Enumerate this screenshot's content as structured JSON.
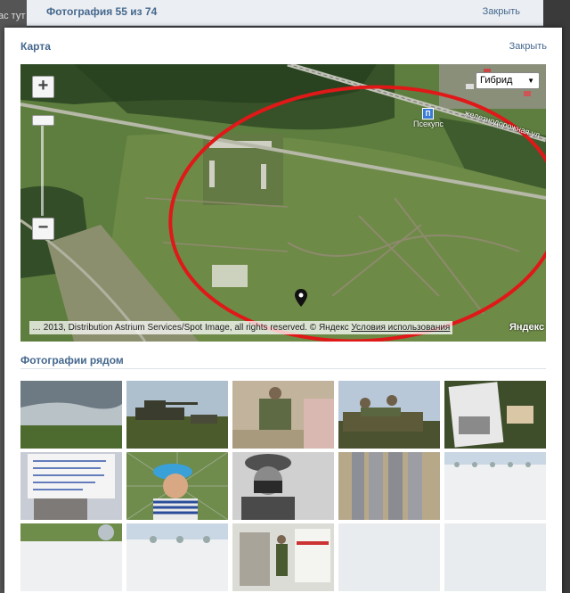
{
  "background": {
    "left_fragment": "ас тут",
    "header_title": "Фотография 55 из 74",
    "header_close": "Закрыть"
  },
  "modal": {
    "title": "Карта",
    "close": "Закрыть"
  },
  "map": {
    "layer_select": "Гибрид",
    "zoom_in": "+",
    "zoom_out": "−",
    "station_label": "Псекупс",
    "road_label": "железнодорожная ул",
    "copyright": "… 2013, Distribution Astrium Services/Spot Image, all rights reserved. © Яндекс",
    "terms": "Условия использования",
    "provider": "Яндекс"
  },
  "nearby": {
    "title": "Фотографии рядом",
    "photos": [
      {
        "subject": "cloudy field"
      },
      {
        "subject": "tanks on field"
      },
      {
        "subject": "soldier sitting"
      },
      {
        "subject": "soldiers on tank"
      },
      {
        "subject": "leaflet and paper"
      },
      {
        "subject": "handwritten letter"
      },
      {
        "subject": "soldier selfie"
      },
      {
        "subject": "soldier portrait"
      },
      {
        "subject": "artillery shells"
      },
      {
        "subject": "loading"
      },
      {
        "subject": "loading"
      },
      {
        "subject": "loading"
      },
      {
        "subject": "soldier at gate"
      },
      {
        "subject": "empty"
      },
      {
        "subject": "empty"
      }
    ]
  }
}
